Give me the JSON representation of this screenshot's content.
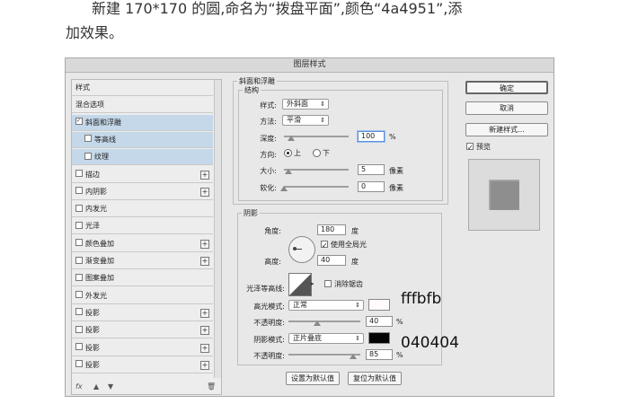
{
  "intro": {
    "line1": "新建 170*170 的圆,命名为“拨盘平面”,颜色“4a4951”,添",
    "line2": "加效果。"
  },
  "dialog": {
    "title": "图层样式",
    "styles_list": [
      {
        "label": "样式",
        "checkbox": false,
        "plus": false,
        "selected": false,
        "indent": false
      },
      {
        "label": "混合选项",
        "checkbox": false,
        "plus": false,
        "selected": false,
        "indent": false
      },
      {
        "label": "斜面和浮雕",
        "checkbox": true,
        "checked": true,
        "plus": false,
        "selected": true,
        "indent": false
      },
      {
        "label": "等高线",
        "checkbox": true,
        "checked": false,
        "plus": false,
        "selected": true,
        "indent": true
      },
      {
        "label": "纹理",
        "checkbox": true,
        "checked": false,
        "plus": false,
        "selected": true,
        "indent": true
      },
      {
        "label": "描边",
        "checkbox": true,
        "checked": false,
        "plus": true,
        "selected": false,
        "indent": false
      },
      {
        "label": "内阴影",
        "checkbox": true,
        "checked": false,
        "plus": true,
        "selected": false,
        "indent": false
      },
      {
        "label": "内发光",
        "checkbox": true,
        "checked": false,
        "plus": false,
        "selected": false,
        "indent": false
      },
      {
        "label": "光泽",
        "checkbox": true,
        "checked": false,
        "plus": false,
        "selected": false,
        "indent": false
      },
      {
        "label": "颜色叠加",
        "checkbox": true,
        "checked": false,
        "plus": true,
        "selected": false,
        "indent": false
      },
      {
        "label": "渐变叠加",
        "checkbox": true,
        "checked": false,
        "plus": true,
        "selected": false,
        "indent": false
      },
      {
        "label": "图案叠加",
        "checkbox": true,
        "checked": false,
        "plus": false,
        "selected": false,
        "indent": false
      },
      {
        "label": "外发光",
        "checkbox": true,
        "checked": false,
        "plus": false,
        "selected": false,
        "indent": false
      },
      {
        "label": "投影",
        "checkbox": true,
        "checked": false,
        "plus": true,
        "selected": false,
        "indent": false
      },
      {
        "label": "投影",
        "checkbox": true,
        "checked": false,
        "plus": true,
        "selected": false,
        "indent": false
      },
      {
        "label": "投影",
        "checkbox": true,
        "checked": false,
        "plus": true,
        "selected": false,
        "indent": false
      },
      {
        "label": "投影",
        "checkbox": true,
        "checked": false,
        "plus": true,
        "selected": false,
        "indent": false
      }
    ],
    "footer_fx": "fx",
    "bevel": {
      "section_title": "斜面和浮雕",
      "structure_title": "结构",
      "style_label": "样式:",
      "style_value": "外斜面",
      "technique_label": "方法:",
      "technique_value": "平滑",
      "depth_label": "深度:",
      "depth_value": "100",
      "depth_unit": "%",
      "direction_label": "方向:",
      "direction_up": "上",
      "direction_down": "下",
      "size_label": "大小:",
      "size_value": "5",
      "size_unit": "像素",
      "soften_label": "软化:",
      "soften_value": "0",
      "soften_unit": "像素"
    },
    "shading": {
      "title": "阴影",
      "angle_label": "角度:",
      "angle_value": "180",
      "angle_unit": "度",
      "global_light_label": "使用全局光",
      "altitude_label": "高度:",
      "altitude_value": "40",
      "altitude_unit": "度",
      "gloss_label": "光泽等高线:",
      "antialias_label": "消除锯齿",
      "highlight_mode_label": "高光模式:",
      "highlight_mode_value": "正常",
      "highlight_opacity_label": "不透明度:",
      "highlight_opacity_value": "40",
      "highlight_color": "#fffbfb",
      "shadow_mode_label": "阴影模式:",
      "shadow_mode_value": "正片叠底",
      "shadow_opacity_label": "不透明度:",
      "shadow_opacity_value": "85",
      "shadow_color": "#040404",
      "percent": "%"
    },
    "buttons": {
      "make_default": "设置为默认值",
      "reset_default": "复位为默认值",
      "ok": "确定",
      "cancel": "取消",
      "new_style": "新建样式...",
      "preview_label": "预览"
    }
  },
  "annotations": {
    "highlight_hex": "fffbfb",
    "shadow_hex": "040404"
  }
}
